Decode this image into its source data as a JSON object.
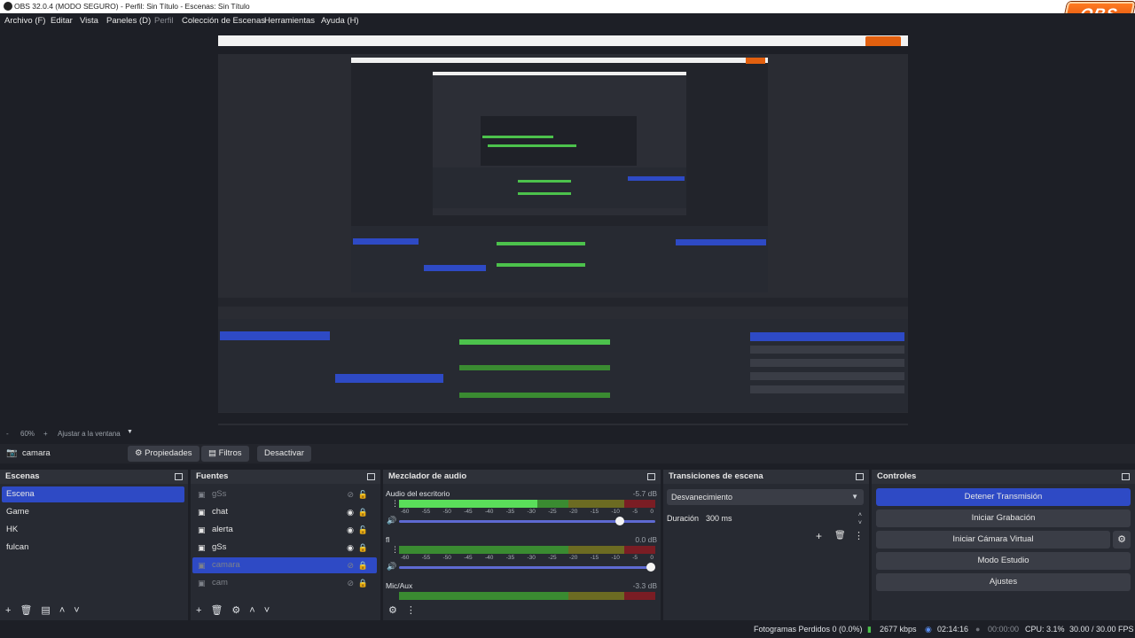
{
  "window": {
    "title": "OBS 32.0.4 (MODO SEGURO) - Perfil: Sin Título - Escenas: Sin Título",
    "brand": "OBS"
  },
  "menu": {
    "archivo": "Archivo (F)",
    "editar": "Editar",
    "vista": "Vista",
    "paneles": "Paneles (D)",
    "perfil": "Perfil",
    "coleccion": "Colección de Escenas",
    "herramientas": "Herramientas",
    "ayuda": "Ayuda (H)"
  },
  "zoom": {
    "minus": "-",
    "value": "60%",
    "plus": "+",
    "fit": "Ajustar a la ventana"
  },
  "source_toolbar": {
    "selected_source": "camara",
    "properties": "Propiedades",
    "filters": "Filtros",
    "deactivate": "Desactivar"
  },
  "scenes": {
    "title": "Escenas",
    "items": [
      "Escena",
      "Game",
      "HK",
      "fulcan"
    ],
    "selected": 0
  },
  "sources": {
    "title": "Fuentes",
    "items": [
      {
        "name": "gSs",
        "visible": false,
        "locked": false
      },
      {
        "name": "chat",
        "visible": true,
        "locked": true
      },
      {
        "name": "alerta",
        "visible": true,
        "locked": false
      },
      {
        "name": "gSs",
        "visible": true,
        "locked": true
      },
      {
        "name": "camara",
        "visible": false,
        "locked": true
      },
      {
        "name": "cam",
        "visible": false,
        "locked": true
      }
    ],
    "selected": 4
  },
  "mixer": {
    "title": "Mezclador de audio",
    "tracks": [
      {
        "name": "Audio del escritorio",
        "db": "-5.7 dB",
        "level": 0.54,
        "volume": 0.88
      },
      {
        "name": "fl",
        "db": "0.0 dB",
        "level": 0.0,
        "volume": 1.0
      },
      {
        "name": "Mic/Aux",
        "db": "-3.3 dB",
        "level": 0.0,
        "volume": 1.0
      }
    ],
    "ticks": [
      "-60",
      "-55",
      "-50",
      "-45",
      "-40",
      "-35",
      "-30",
      "-25",
      "-20",
      "-15",
      "-10",
      "-5",
      "0"
    ]
  },
  "transitions": {
    "title": "Transiciones de escena",
    "type": "Desvanecimiento",
    "duration_label": "Duración",
    "duration_value": "300 ms"
  },
  "controls": {
    "title": "Controles",
    "stop_stream": "Detener Transmisión",
    "start_recording": "Iniciar Grabación",
    "start_virtual_cam": "Iniciar Cámara Virtual",
    "studio_mode": "Modo Estudio",
    "settings": "Ajustes"
  },
  "status": {
    "dropped_frames": "Fotogramas Perdidos 0 (0.0%)",
    "bitrate": "2677 kbps",
    "stream_time": "02:14:16",
    "record_time": "00:00:00",
    "cpu": "CPU: 3.1%",
    "fps": "30.00 / 30.00 FPS"
  },
  "colors": {
    "accent": "#2e4ac5",
    "panel": "#272a32",
    "background": "#1d1f26"
  }
}
